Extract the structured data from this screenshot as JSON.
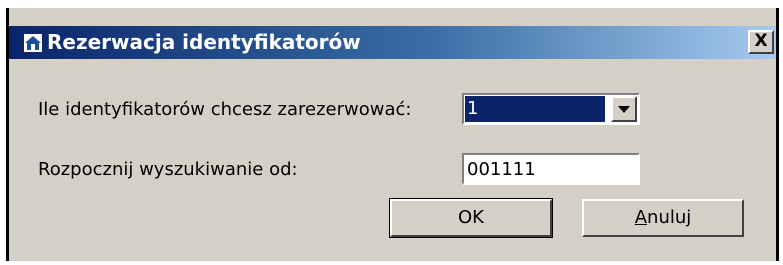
{
  "window": {
    "title": "Rezerwacja identyfikatorów",
    "close_label": "X",
    "icon": "house-icon"
  },
  "form": {
    "count_label": "Ile identyfikatorów chcesz zarezerwować:",
    "count_value": "1",
    "start_label": "Rozpocznij wyszukiwanie od:",
    "start_value": "001111"
  },
  "buttons": {
    "ok_label": "OK",
    "cancel_label_accel": "A",
    "cancel_label_rest": "nuluj"
  },
  "colors": {
    "titlebar_start": "#0a246a",
    "titlebar_end": "#a6caf0",
    "dialog_bg": "#d4d0c8",
    "selection": "#0a246a"
  }
}
